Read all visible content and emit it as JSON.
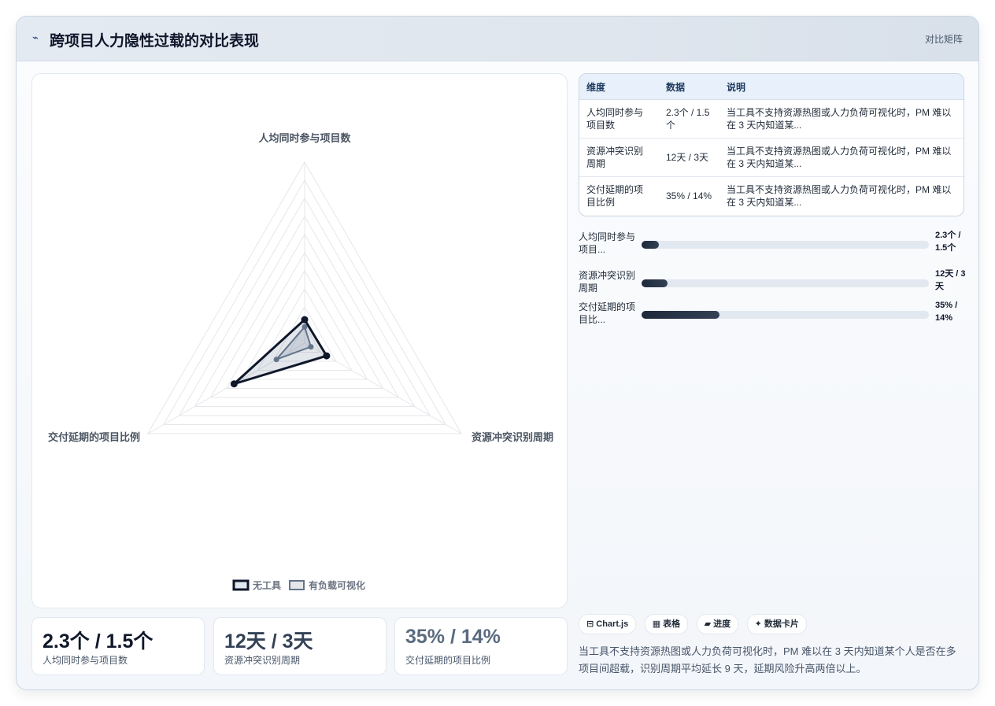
{
  "header": {
    "icon": "line-chart-icon",
    "title": "跨项目人力隐性过载的对比表现",
    "tag": "对比矩阵"
  },
  "chart_data": {
    "type": "radar",
    "axes": [
      "人均同时参与项目数",
      "资源冲突识别周期",
      "交付延期的项目比例"
    ],
    "max": 100,
    "grid_levels": 10,
    "series": [
      {
        "name": "无工具",
        "values": [
          13,
          14,
          45
        ],
        "color": "#0f172a"
      },
      {
        "name": "有负载可视化",
        "values": [
          9,
          4,
          18
        ],
        "color": "#64748b"
      }
    ]
  },
  "legend": {
    "series": [
      "无工具",
      "有负载可视化"
    ]
  },
  "table": {
    "headers": [
      "维度",
      "数据",
      "说明"
    ],
    "rows": [
      [
        "人均同时参与项目数",
        "2.3个 / 1.5个",
        "当工具不支持资源热图或人力负荷可视化时，PM 难以在 3 天内知道某..."
      ],
      [
        "资源冲突识别周期",
        "12天 / 3天",
        "当工具不支持资源热图或人力负荷可视化时，PM 难以在 3 天内知道某..."
      ],
      [
        "交付延期的项目比例",
        "35% / 14%",
        "当工具不支持资源热图或人力负荷可视化时，PM 难以在 3 天内知道某..."
      ]
    ]
  },
  "progress": [
    {
      "label": "人均同时参与项目...",
      "value": "2.3个 / 1.5个",
      "fraction": 0.06
    },
    {
      "label": "资源冲突识别周期",
      "value": "12天 / 3天",
      "fraction": 0.09
    },
    {
      "label": "交付延期的项目比...",
      "value": "35% / 14%",
      "fraction": 0.27
    }
  ],
  "kpis": [
    {
      "value": "2.3个 / 1.5个",
      "label": "人均同时参与项目数",
      "color": "#0f172a"
    },
    {
      "value": "12天 / 3天",
      "label": "资源冲突识别周期",
      "color": "#334155"
    },
    {
      "value": "35% / 14%",
      "label": "交付延期的项目比例",
      "color": "#5b6b80"
    }
  ],
  "chips": [
    "⊟ Chart.js",
    "▦ 表格",
    "▰ 进度",
    "✦ 数据卡片"
  ],
  "summary": "当工具不支持资源热图或人力负荷可视化时，PM 难以在 3 天内知道某个人是否在多项目间超载，识别周期平均延长 9 天，延期风险升高两倍以上。"
}
